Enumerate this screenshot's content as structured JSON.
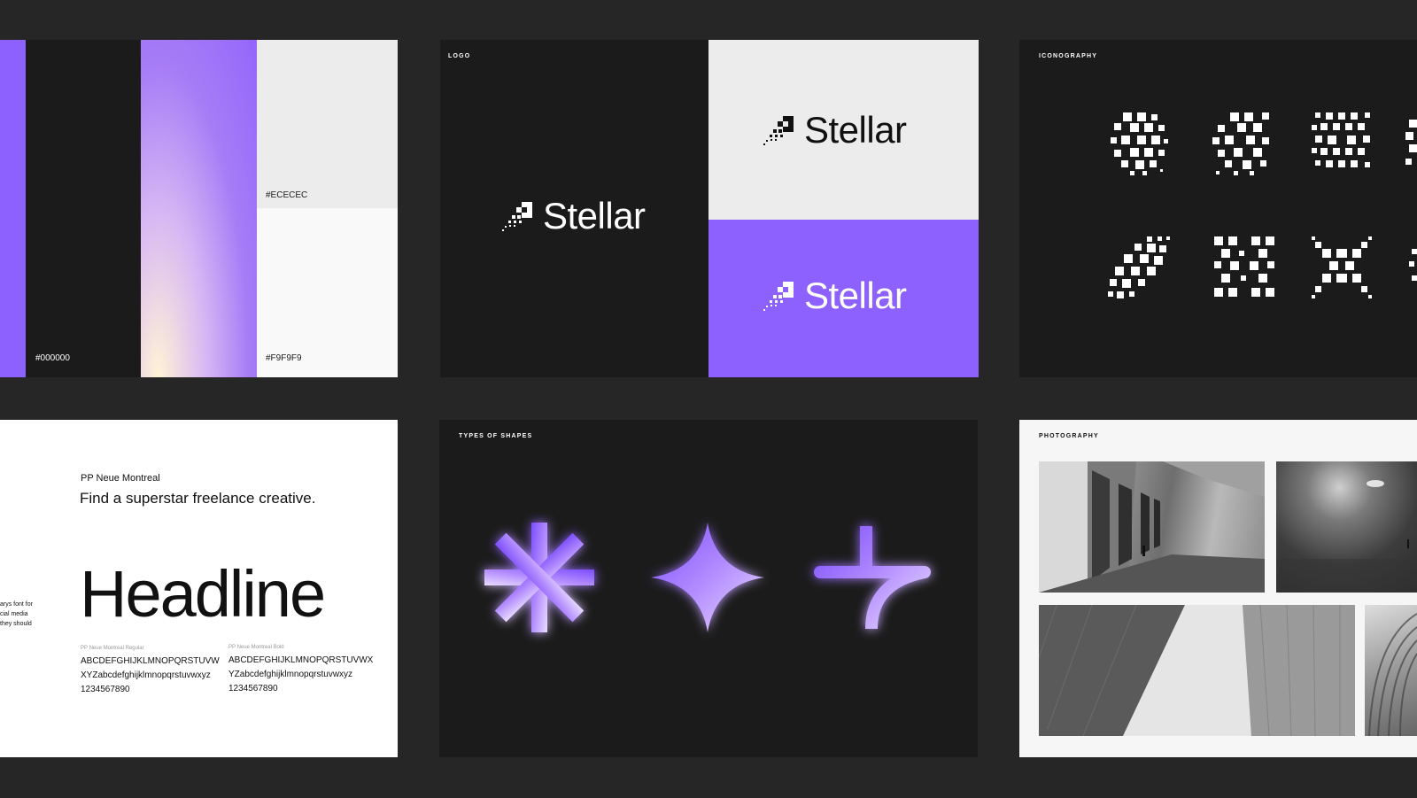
{
  "palette": {
    "hex_black": "#000000",
    "hex_light": "#ECECEC",
    "hex_white": "#F9F9F9",
    "colors": {
      "purple": "#8c61fd",
      "black": "#1b1b1b",
      "light": "#ececec",
      "white": "#f9f9f9"
    }
  },
  "logo": {
    "label": "LOGO",
    "wordmark": "Stellar"
  },
  "icons": {
    "label": "ICONOGRAPHY",
    "names": [
      "pixel-circle-icon",
      "pixel-burst-icon",
      "pixel-grid-icon",
      "pixel-leaf-icon",
      "pixel-cross-icon",
      "pixel-x-icon"
    ]
  },
  "typography": {
    "font_name": "PP Neue Montreal",
    "tagline": "Find a superstar freelance creative.",
    "side_text": [
      "arys font for",
      "cial media",
      "they should"
    ],
    "headline": "Headline",
    "regular_label": "PP Neue Montreal Regular",
    "bold_label": "PP Neue Montreal Bold",
    "regular_lines": [
      "ABCDEFGHIJKLMNOPQRSTUVW",
      "XYZabcdefghijklmnopqrstuvwxyz",
      "1234567890"
    ],
    "bold_lines": [
      "ABCDEFGHIJKLMNOPQRSTUVWX",
      "YZabcdefghijklmnopqrstuvwxyz",
      "1234567890"
    ]
  },
  "shapes": {
    "label": "TYPES OF SHAPES"
  },
  "photography": {
    "label": "PHOTOGRAPHY"
  }
}
